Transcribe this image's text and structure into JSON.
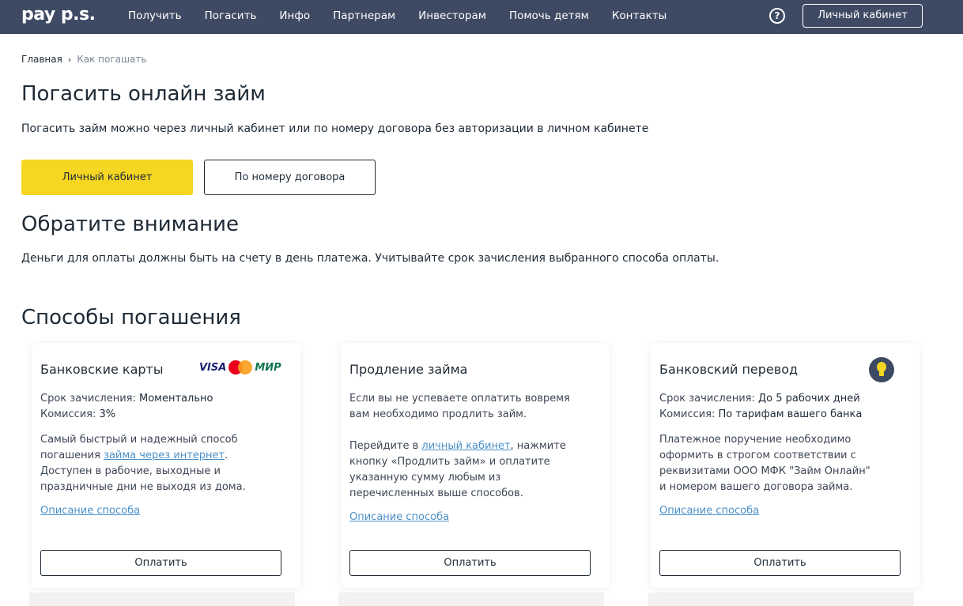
{
  "header": {
    "logo": "pay p.s.",
    "nav": [
      "Получить",
      "Погасить",
      "Инфо",
      "Партнерам",
      "Инвесторам",
      "Помочь детям",
      "Контакты"
    ],
    "help_symbol": "?",
    "cabinet_label": "Личный кабинет",
    "colors": {
      "background": "#3e4a63",
      "text": "#ffffff"
    }
  },
  "breadcrumb": {
    "home": "Главная",
    "separator": "›",
    "current": "Как погашать"
  },
  "page": {
    "title": "Погасить онлайн займ",
    "subtitle": "Погасить займ можно через личный кабинет или по номеру договора без авторизации в личном кабинете",
    "btn_cabinet": "Личный кабинет",
    "btn_contract": "По номеру договора",
    "accent_color": "#f5d622"
  },
  "attention": {
    "title": "Обратите внимание",
    "text": "Деньги для оплаты должны быть на счету в день платежа. Учитывайте срок зачисления выбранного способа оплаты."
  },
  "methods": {
    "title": "Способы погашения",
    "cards": [
      {
        "title": "Банковские карты",
        "logos": {
          "visa": "VISA",
          "mir": "МИР"
        },
        "term_label": "Срок зачисления: ",
        "term_value": "Моментально",
        "fee_label": "Комиссия: ",
        "fee_value": "3%",
        "desc_before": "Самый быстрый и надежный способ погашения ",
        "desc_link": "займа через интернет",
        "desc_after": ". Доступен в рабочие, выходные и праздничные дни не выходя из дома.",
        "link": "Описание способа",
        "button": "Оплатить"
      },
      {
        "title": "Продление займа",
        "p1": "Если вы не успеваете оплатить вовремя вам необходимо продлить займ.",
        "p2_before": "Перейдите в ",
        "p2_link": "личный кабинет",
        "p2_after": ", нажмите кнопку «Продлить займ» и оплатите указанную сумму любым из перечисленных выше способов.",
        "link": "Описание способа",
        "button": "Оплатить"
      },
      {
        "title": "Банковский перевод",
        "icon": "lightbulb-icon",
        "term_label": "Срок зачисления: ",
        "term_value": "До 5 рабочих дней",
        "fee_label": "Комиссия: ",
        "fee_value": "По тарифам вашего банка",
        "desc": "Платежное поручение необходимо оформить в строгом соответствии с реквизитами ООО МФК \"Займ Онлайн\" и номером вашего договора займа.",
        "link": "Описание способа",
        "button": "Оплатить"
      }
    ]
  }
}
